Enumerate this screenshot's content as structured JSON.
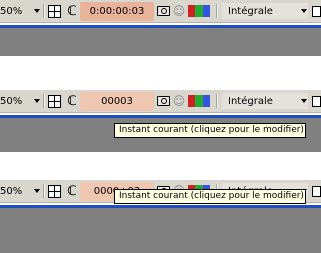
{
  "panels": [
    {
      "zoom": "50%",
      "time": "0:00:00:03",
      "quality": "Intégrale",
      "tooltip": ""
    },
    {
      "zoom": "50%",
      "time": "00003",
      "quality": "Intégrale",
      "tooltip": "Instant courant (cliquez pour le modifier)"
    },
    {
      "zoom": "50%",
      "time": "0000+03",
      "quality": "Intégrale",
      "tooltip": "Instant courant (cliquez pour le modifier)"
    }
  ],
  "colors": {
    "blue_line": "#1f4fbf",
    "time_highlight": "#e9b29b",
    "channel_red": "#cc2222",
    "channel_green": "#22aa33",
    "channel_blue": "#3355dd"
  },
  "icons": [
    "grid-icon",
    "mask-icon",
    "camera-icon",
    "person-icon",
    "rgb-channels-icon",
    "chevron-down-icon"
  ]
}
